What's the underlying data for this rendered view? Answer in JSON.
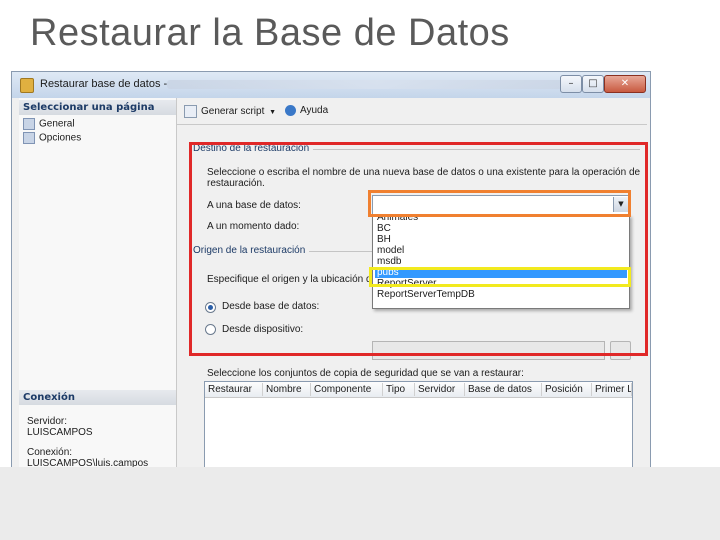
{
  "slide": {
    "title": "Restaurar la Base de Datos"
  },
  "window": {
    "title": "Restaurar base de datos -",
    "min": "–",
    "max": "□",
    "close": "✕"
  },
  "left_pane": {
    "select_page_header": "Seleccionar una página",
    "pages": [
      "General",
      "Opciones"
    ],
    "connection_header": "Conexión",
    "server_label": "Servidor:",
    "server_value": "LUISCAMPOS",
    "connection_label": "Conexión:",
    "connection_value": "LUISCAMPOS\\luis.campos"
  },
  "toolbar": {
    "script_label": "Generar script",
    "help_label": "Ayuda",
    "script_icon": "script-icon",
    "help_icon": "help-icon"
  },
  "destination": {
    "group_title": "Destino de la restauración",
    "description_line1": "Seleccione o escriba el nombre de una nueva base de datos o una existente para la operación de",
    "description_line2": "restauración.",
    "to_database_label": "A una base de datos:",
    "to_database_value": "",
    "to_point_label": "A un momento dado:"
  },
  "database_dropdown": {
    "options": [
      "Animales",
      "BC",
      "BH",
      "model",
      "msdb",
      "pubs",
      "ReportServer",
      "ReportServerTempDB"
    ],
    "selected": "pubs"
  },
  "source": {
    "group_title": "Origen de la restauración",
    "specify_label": "Especifique el origen y la ubicación de",
    "from_database_label": "Desde base de datos:",
    "from_device_label": "Desde dispositivo:",
    "selected_option": "Desde base de datos:"
  },
  "backup_sets": {
    "label": "Seleccione los conjuntos de copia de seguridad que se van a restaurar:",
    "columns": [
      "Restaurar",
      "Nombre",
      "Componente",
      "Tipo",
      "Servidor",
      "Base de datos",
      "Posición",
      "Primer L"
    ]
  },
  "highlights": {
    "red": "#e02828",
    "orange": "#f08030",
    "yellow": "#f2ea1e"
  }
}
